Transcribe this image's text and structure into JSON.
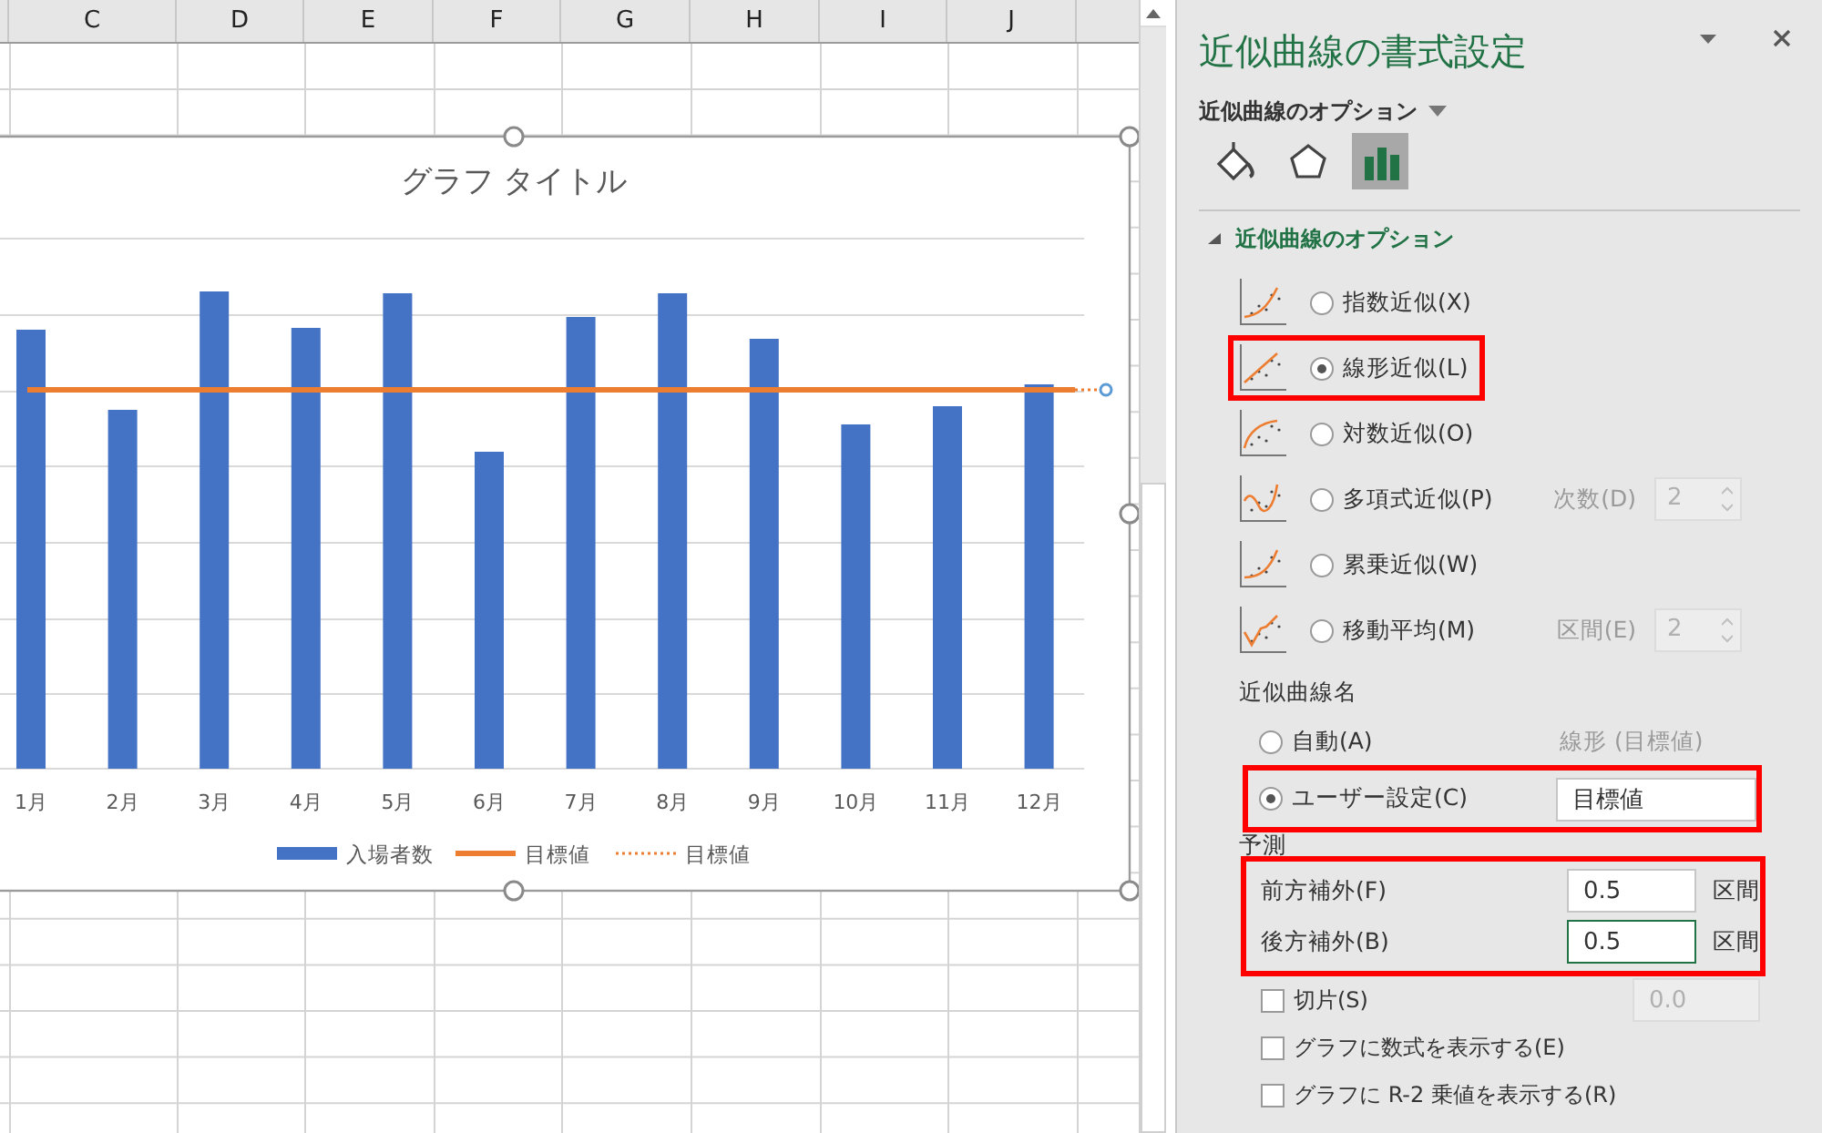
{
  "sheet": {
    "columns": [
      "C",
      "D",
      "E",
      "F",
      "G",
      "H",
      "I",
      "J"
    ]
  },
  "chart": {
    "title": "グラフ タイトル",
    "categories": [
      "1月",
      "2月",
      "3月",
      "4月",
      "5月",
      "6月",
      "7月",
      "8月",
      "9月",
      "10月",
      "11月",
      "12月"
    ],
    "legend": [
      {
        "label": "入場者数",
        "kind": "bar"
      },
      {
        "label": "目標値",
        "kind": "line"
      },
      {
        "label": "目標値",
        "kind": "dotted"
      }
    ]
  },
  "panel": {
    "title": "近似曲線の書式設定",
    "menu": "近似曲線のオプション",
    "tabs": [
      {
        "kind": "fill",
        "selected": false
      },
      {
        "kind": "effects",
        "selected": false
      },
      {
        "kind": "options",
        "selected": true
      }
    ],
    "section": {
      "title": "近似曲線のオプション",
      "expanded": true
    },
    "types": [
      {
        "kind": "exponential",
        "label": "指数近似(X)",
        "selected": false,
        "highlighted": false
      },
      {
        "kind": "linear",
        "label": "線形近似(L)",
        "selected": true,
        "highlighted": true
      },
      {
        "kind": "logarithmic",
        "label": "対数近似(O)",
        "selected": false,
        "highlighted": false
      },
      {
        "kind": "polynomial",
        "label": "多項式近似(P)",
        "selected": false,
        "highlighted": false,
        "param": {
          "label": "次数(D)",
          "value": "2",
          "disabled": true
        }
      },
      {
        "kind": "power",
        "label": "累乗近似(W)",
        "selected": false,
        "highlighted": false
      },
      {
        "kind": "moving-average",
        "label": "移動平均(M)",
        "selected": false,
        "highlighted": false,
        "param": {
          "label": "区間(E)",
          "value": "2",
          "disabled": true
        }
      }
    ],
    "name_title": "近似曲線名",
    "name_options": [
      {
        "kind": "text",
        "label": "自動(A)",
        "selected": false,
        "highlighted": false,
        "value": "線形 (目標値)"
      },
      {
        "kind": "input",
        "label": "ユーザー設定(C)",
        "selected": true,
        "highlighted": true,
        "value": "目標値"
      }
    ],
    "forecast": {
      "title": "予測",
      "highlighted": true,
      "rows": [
        {
          "label": "前方補外(F)",
          "value": "0.5",
          "unit": "区間",
          "focused": false
        },
        {
          "label": "後方補外(B)",
          "value": "0.5",
          "unit": "区間",
          "focused": true
        }
      ]
    },
    "checks": [
      {
        "label": "切片(S)",
        "checked": false,
        "value": "0.0"
      },
      {
        "label": "グラフに数式を表示する(E)",
        "checked": false
      },
      {
        "label": "グラフに R-2 乗値を表示する(R)",
        "checked": false
      }
    ]
  }
}
